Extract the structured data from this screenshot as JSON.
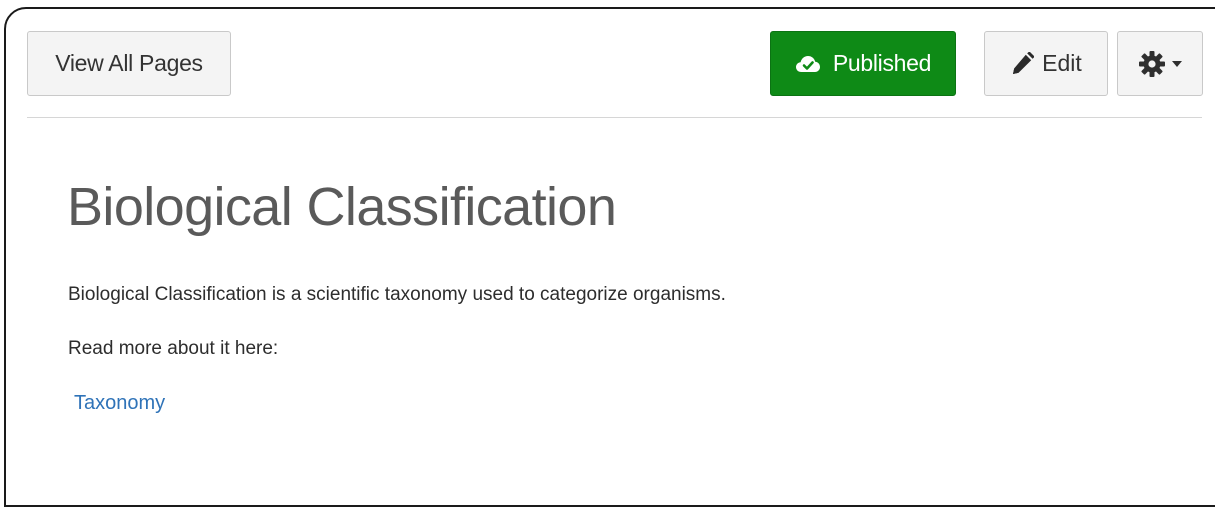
{
  "toolbar": {
    "view_all_label": "View All Pages",
    "published_label": "Published",
    "edit_label": "Edit"
  },
  "icons": {
    "published": "cloud-check-icon",
    "edit": "pencil-icon",
    "settings": "gear-icon",
    "settings_menu": "caret-down-icon"
  },
  "colors": {
    "published_bg": "#0e8a16",
    "link": "#2f73b8",
    "title": "#5a5a5a"
  },
  "page": {
    "title": "Biological Classification",
    "paragraphs": [
      "Biological Classification is a scientific taxonomy used to categorize organisms.",
      "Read more about it here:"
    ],
    "link_text": "Taxonomy"
  }
}
